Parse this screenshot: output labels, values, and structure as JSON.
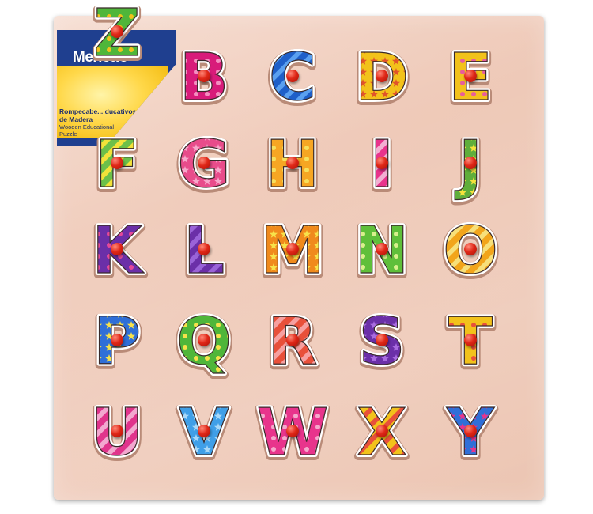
{
  "label": {
    "brand": "Merletto",
    "line1": "Rompecabe... ducativos",
    "line2": "de Madera",
    "line3": "Wooden Educational",
    "line4": "Puzzle"
  },
  "letters": [
    {
      "char": "B",
      "color": "#d81b7a",
      "accent": "#f48fc0"
    },
    {
      "char": "C",
      "color": "#1e5fc9",
      "accent": "#5aa0f0"
    },
    {
      "char": "D",
      "color": "#f2c21b",
      "accent": "#e0542a"
    },
    {
      "char": "E",
      "color": "#f2c21b",
      "accent": "#e85d9c"
    },
    {
      "char": "F",
      "color": "#6cc04a",
      "accent": "#f2e23a"
    },
    {
      "char": "G",
      "color": "#e84c8b",
      "accent": "#f7a8cb"
    },
    {
      "char": "H",
      "color": "#f6a623",
      "accent": "#f6e05c"
    },
    {
      "char": "I",
      "color": "#e8348c",
      "accent": "#f2b0d2"
    },
    {
      "char": "J",
      "color": "#5fae3b",
      "accent": "#f5e23c"
    },
    {
      "char": "K",
      "color": "#6b2fa8",
      "accent": "#e4489a"
    },
    {
      "char": "L",
      "color": "#6b2fa8",
      "accent": "#9a63d8"
    },
    {
      "char": "M",
      "color": "#f08a1c",
      "accent": "#f7e24a"
    },
    {
      "char": "N",
      "color": "#5fbf3a",
      "accent": "#d8f08c"
    },
    {
      "char": "O",
      "color": "#f2a51b",
      "accent": "#f7e07a"
    },
    {
      "char": "P",
      "color": "#2f6fd8",
      "accent": "#f7e24a"
    },
    {
      "char": "Q",
      "color": "#4fb63a",
      "accent": "#f7e24a"
    },
    {
      "char": "R",
      "color": "#e8503a",
      "accent": "#f6a0a0"
    },
    {
      "char": "S",
      "color": "#6b2fa8",
      "accent": "#a96ce0"
    },
    {
      "char": "T",
      "color": "#f2c21b",
      "accent": "#e8503a"
    },
    {
      "char": "U",
      "color": "#e0348c",
      "accent": "#f2a8cf"
    },
    {
      "char": "V",
      "color": "#3f9fe8",
      "accent": "#a8d8f8"
    },
    {
      "char": "W",
      "color": "#e8348c",
      "accent": "#f5a8cc"
    },
    {
      "char": "X",
      "color": "#f2c21b",
      "accent": "#e8503a"
    },
    {
      "char": "Y",
      "color": "#2f6fd8",
      "accent": "#e8348c"
    },
    {
      "char": "Z",
      "color": "#4fb63a",
      "accent": "#f2c21b"
    }
  ]
}
